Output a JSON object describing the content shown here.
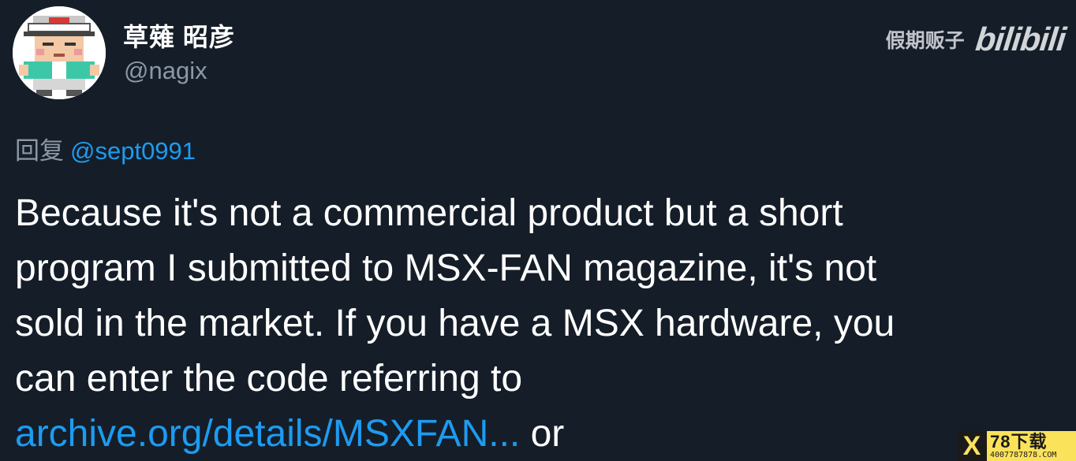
{
  "author": {
    "display_name": "草薙 昭彦",
    "handle": "@nagix",
    "avatar_icon": "pixel-character-avatar-icon"
  },
  "watermark": {
    "text": "假期贩子",
    "logo_text": "bilibili"
  },
  "reply": {
    "prefix": "回复",
    "target": "@sept0991"
  },
  "tweet": {
    "lines": [
      "Because it's not a commercial product but a short",
      "program I submitted to MSX-FAN magazine, it's not",
      "sold in the market. If you have a MSX hardware, you",
      "can enter the code referring to"
    ],
    "link_text": "archive.org/details/MSXFAN...",
    "trailing_text": " or"
  },
  "corner_badge": {
    "icon_letter": "X",
    "main_text": "78下载",
    "sub_text": "4007787878.COM"
  },
  "colors": {
    "background": "#151d28",
    "text": "#ffffff",
    "muted": "#8b98a5",
    "link": "#1d9bf0",
    "badge": "#fbe25b"
  }
}
